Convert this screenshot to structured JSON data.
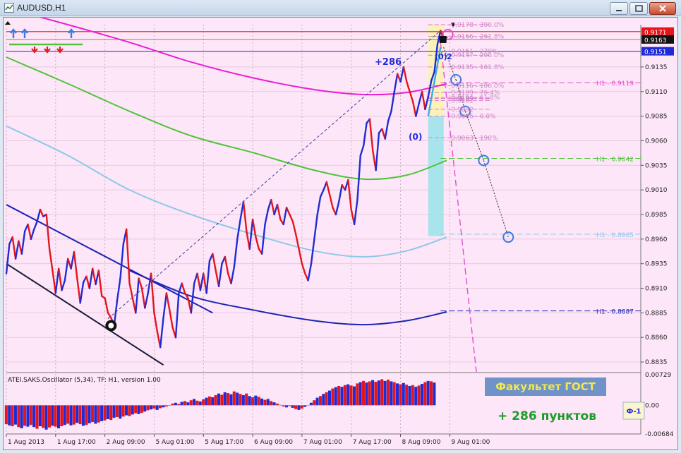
{
  "window": {
    "title": "AUDUSD,H1"
  },
  "colors": {
    "background": "#fde6f7",
    "bull_leg": "#1f2bd6",
    "bear_leg": "#e4161c",
    "ma_magenta": "#ea1fd3",
    "ma_green": "#4fc33a",
    "ma_lightblue": "#8fc8e8",
    "channel_blue": "#1b24b4",
    "channel_dark": "#1a1a3a",
    "fib": "#e07ad0",
    "hist_blue": "#1f2bd6",
    "hist_red": "#e4161c",
    "badge_bg": "#6f93c9",
    "pips_text": "#1f9b2c"
  },
  "chart_data": {
    "type": "line",
    "symbol": "AUDUSD",
    "timeframe": "H1",
    "ylim": [
      0.8825,
      0.9178
    ],
    "y_ticks": [
      "0.9135",
      "0.9110",
      "0.9085",
      "0.9060",
      "0.9035",
      "0.9010",
      "0.8985",
      "0.8960",
      "0.8935",
      "0.8910",
      "0.8885",
      "0.8860",
      "0.8835"
    ],
    "y_tick_values": [
      0.9135,
      0.911,
      0.9085,
      0.906,
      0.9035,
      0.901,
      0.8985,
      0.896,
      0.8935,
      0.891,
      0.8885,
      0.886,
      0.8835
    ],
    "x_ticks": [
      "1 Aug 2013",
      "1 Aug 17:00",
      "2 Aug 09:00",
      "5 Aug 01:00",
      "5 Aug 17:00",
      "6 Aug 09:00",
      "7 Aug 01:00",
      "7 Aug 17:00",
      "8 Aug 09:00",
      "9 Aug 01:00"
    ],
    "x_tick_index": [
      0,
      16,
      32,
      48,
      64,
      80,
      96,
      112,
      128,
      144
    ],
    "price_tags": [
      {
        "label": "0.9171",
        "value": 0.9171,
        "bg": "#e4161c"
      },
      {
        "label": "0.9163",
        "value": 0.9163,
        "bg": "#111111"
      },
      {
        "label": "0.9151",
        "value": 0.9151,
        "bg": "#1f2bd6"
      }
    ],
    "series": [
      {
        "values": [
          [
            0,
            0.8925
          ],
          [
            1,
            0.8955
          ],
          [
            2,
            0.8962
          ],
          [
            3,
            0.894
          ],
          [
            4,
            0.8958
          ],
          [
            5,
            0.8945
          ],
          [
            6,
            0.8968
          ],
          [
            7,
            0.8975
          ],
          [
            8,
            0.896
          ],
          [
            9,
            0.897
          ],
          [
            10,
            0.8978
          ],
          [
            11,
            0.899
          ],
          [
            12,
            0.8983
          ],
          [
            13,
            0.8985
          ],
          [
            14,
            0.895
          ],
          [
            15,
            0.8928
          ],
          [
            16,
            0.8905
          ],
          [
            17,
            0.893
          ],
          [
            18,
            0.8908
          ],
          [
            19,
            0.8918
          ],
          [
            20,
            0.894
          ],
          [
            21,
            0.893
          ],
          [
            22,
            0.8947
          ],
          [
            23,
            0.892
          ],
          [
            24,
            0.8895
          ],
          [
            25,
            0.8916
          ],
          [
            26,
            0.8922
          ],
          [
            27,
            0.891
          ],
          [
            28,
            0.893
          ],
          [
            29,
            0.8914
          ],
          [
            30,
            0.8928
          ],
          [
            31,
            0.8902
          ],
          [
            32,
            0.89
          ],
          [
            33,
            0.8885
          ],
          [
            34,
            0.888
          ],
          [
            35,
            0.8872
          ],
          [
            36,
            0.8898
          ],
          [
            37,
            0.892
          ],
          [
            38,
            0.8955
          ],
          [
            39,
            0.897
          ],
          [
            40,
            0.8915
          ],
          [
            41,
            0.89
          ],
          [
            42,
            0.8885
          ],
          [
            43,
            0.892
          ],
          [
            44,
            0.891
          ],
          [
            45,
            0.889
          ],
          [
            46,
            0.8905
          ],
          [
            47,
            0.8925
          ],
          [
            48,
            0.8885
          ],
          [
            49,
            0.8866
          ],
          [
            50,
            0.885
          ],
          [
            51,
            0.888
          ],
          [
            52,
            0.8905
          ],
          [
            53,
            0.8888
          ],
          [
            54,
            0.887
          ],
          [
            55,
            0.886
          ],
          [
            56,
            0.8905
          ],
          [
            57,
            0.8915
          ],
          [
            58,
            0.8905
          ],
          [
            59,
            0.89
          ],
          [
            60,
            0.8885
          ],
          [
            61,
            0.8915
          ],
          [
            62,
            0.8925
          ],
          [
            63,
            0.8908
          ],
          [
            64,
            0.8925
          ],
          [
            65,
            0.8905
          ],
          [
            66,
            0.8938
          ],
          [
            67,
            0.8945
          ],
          [
            68,
            0.8928
          ],
          [
            69,
            0.8912
          ],
          [
            70,
            0.8935
          ],
          [
            71,
            0.8942
          ],
          [
            72,
            0.8925
          ],
          [
            73,
            0.8915
          ],
          [
            74,
            0.8932
          ],
          [
            75,
            0.896
          ],
          [
            76,
            0.898
          ],
          [
            77,
            0.8998
          ],
          [
            78,
            0.8968
          ],
          [
            79,
            0.895
          ],
          [
            80,
            0.898
          ],
          [
            81,
            0.8962
          ],
          [
            82,
            0.895
          ],
          [
            83,
            0.8945
          ],
          [
            84,
            0.8975
          ],
          [
            85,
            0.899
          ],
          [
            86,
            0.9
          ],
          [
            87,
            0.8985
          ],
          [
            88,
            0.8995
          ],
          [
            89,
            0.898
          ],
          [
            90,
            0.8975
          ],
          [
            91,
            0.8992
          ],
          [
            92,
            0.8985
          ],
          [
            93,
            0.8978
          ],
          [
            94,
            0.8965
          ],
          [
            95,
            0.895
          ],
          [
            96,
            0.8935
          ],
          [
            97,
            0.8925
          ],
          [
            98,
            0.8918
          ],
          [
            99,
            0.8935
          ],
          [
            100,
            0.896
          ],
          [
            101,
            0.8985
          ],
          [
            102,
            0.9003
          ],
          [
            103,
            0.901
          ],
          [
            104,
            0.9018
          ],
          [
            105,
            0.9005
          ],
          [
            106,
            0.8992
          ],
          [
            107,
            0.8985
          ],
          [
            108,
            0.8998
          ],
          [
            109,
            0.9015
          ],
          [
            110,
            0.901
          ],
          [
            111,
            0.902
          ],
          [
            112,
            0.899
          ],
          [
            113,
            0.8975
          ],
          [
            114,
            0.9
          ],
          [
            115,
            0.9045
          ],
          [
            116,
            0.9055
          ],
          [
            117,
            0.9078
          ],
          [
            118,
            0.9082
          ],
          [
            119,
            0.905
          ],
          [
            120,
            0.903
          ],
          [
            121,
            0.9068
          ],
          [
            122,
            0.9072
          ],
          [
            123,
            0.9062
          ],
          [
            124,
            0.908
          ],
          [
            125,
            0.909
          ],
          [
            126,
            0.911
          ],
          [
            127,
            0.9128
          ],
          [
            128,
            0.912
          ],
          [
            129,
            0.9135
          ],
          [
            130,
            0.912
          ],
          [
            131,
            0.911
          ],
          [
            132,
            0.91
          ],
          [
            133,
            0.9085
          ],
          [
            134,
            0.9098
          ],
          [
            135,
            0.911
          ],
          [
            136,
            0.9092
          ],
          [
            137,
            0.9105
          ],
          [
            138,
            0.9121
          ],
          [
            139,
            0.913
          ],
          [
            140,
            0.9158
          ],
          [
            141,
            0.9172
          ],
          [
            142,
            0.9163
          ],
          [
            143,
            0.9165
          ]
        ]
      }
    ],
    "moving_averages": [
      {
        "color": "#ea1fd3",
        "values": [
          [
            0,
            0.9195
          ],
          [
            20,
            0.9178
          ],
          [
            40,
            0.916
          ],
          [
            60,
            0.914
          ],
          [
            80,
            0.9124
          ],
          [
            100,
            0.9112
          ],
          [
            116,
            0.9107
          ],
          [
            130,
            0.9109
          ],
          [
            143,
            0.9118
          ]
        ]
      },
      {
        "color": "#4fc33a",
        "values": [
          [
            0,
            0.9145
          ],
          [
            20,
            0.9118
          ],
          [
            40,
            0.909
          ],
          [
            60,
            0.9065
          ],
          [
            80,
            0.9048
          ],
          [
            100,
            0.903
          ],
          [
            116,
            0.9021
          ],
          [
            130,
            0.9025
          ],
          [
            143,
            0.904
          ]
        ]
      },
      {
        "color": "#8fc8e8",
        "values": [
          [
            0,
            0.9075
          ],
          [
            20,
            0.9045
          ],
          [
            40,
            0.901
          ],
          [
            60,
            0.8985
          ],
          [
            80,
            0.8965
          ],
          [
            100,
            0.8948
          ],
          [
            116,
            0.8942
          ],
          [
            130,
            0.8948
          ],
          [
            143,
            0.8962
          ]
        ]
      },
      {
        "color": "#1b24b4",
        "values": [
          [
            40,
            0.8928
          ],
          [
            60,
            0.8902
          ],
          [
            80,
            0.8888
          ],
          [
            100,
            0.8877
          ],
          [
            116,
            0.8873
          ],
          [
            130,
            0.8877
          ],
          [
            143,
            0.8886
          ]
        ]
      }
    ],
    "channel": [
      {
        "color": "#1b24b4",
        "from": [
          0,
          0.8995
        ],
        "to": [
          67,
          0.8885
        ]
      },
      {
        "color": "#1a1a3a",
        "from": [
          0,
          0.8935
        ],
        "to": [
          51,
          0.8832
        ]
      }
    ],
    "forecast_path": [
      [
        142,
        0.9155
      ],
      [
        146,
        0.9122
      ],
      [
        149,
        0.909
      ],
      [
        155,
        0.904
      ],
      [
        163,
        0.8962
      ]
    ],
    "fib_levels": [
      {
        "label": "0.9178 - 300.0%",
        "value": 0.9178
      },
      {
        "label": "0.9166 - 261.8%",
        "value": 0.9166
      },
      {
        "label": "0.9151 - 270%",
        "value": 0.9151
      },
      {
        "label": "0.9147 - 200.0%",
        "value": 0.9147
      },
      {
        "label": "0.9135 - 161.8%",
        "value": 0.9135
      },
      {
        "label": "0.9116 - 100.0%",
        "value": 0.9116
      },
      {
        "label": "0.9109 - 76.4%",
        "value": 0.9109
      },
      {
        "label": "0.9104 - 61.8%",
        "value": 0.9104
      },
      {
        "label": "0.9103",
        "value": 0.9103
      },
      {
        "label": "0.9101",
        "value": 0.9101
      },
      {
        "label": "0.9092",
        "value": 0.9092
      },
      {
        "label": "0.9085 - 0.0%",
        "value": 0.9085
      },
      {
        "label": "0.9063 - 190%",
        "value": 0.9063
      }
    ],
    "h1_levels": [
      {
        "label": "H1 - 0.9119",
        "value": 0.9119,
        "color": "#e04fd0"
      },
      {
        "label": "H1 - 0.9042",
        "value": 0.9042,
        "color": "#4fc33a"
      },
      {
        "label": "H1 - 0.8965",
        "value": 0.8965,
        "color": "#8fc8e8"
      },
      {
        "label": "H1 - 0.8887",
        "value": 0.8887,
        "color": "#1b24b4"
      }
    ],
    "annotations": {
      "plus": "+286",
      "zero": "(0)",
      "zero_b": "(0)",
      "zero_c": "2"
    },
    "oscillator": {
      "title": "ATEI.SAKS.Oscillator (5,34), TF: H1, version 1.00",
      "ylim": [
        -0.00684,
        0.00729
      ],
      "y_ticks": [
        "0.00729",
        "0.00",
        "-0.00684"
      ],
      "y_tick_values": [
        0.00729,
        0.0,
        -0.00684
      ],
      "values": [
        -0.0045,
        -0.0048,
        -0.005,
        -0.0046,
        -0.0052,
        -0.0055,
        -0.0049,
        -0.0051,
        -0.0047,
        -0.0052,
        -0.0056,
        -0.005,
        -0.0054,
        -0.0058,
        -0.0053,
        -0.0049,
        -0.0051,
        -0.0055,
        -0.005,
        -0.0047,
        -0.0044,
        -0.0048,
        -0.0046,
        -0.0042,
        -0.0045,
        -0.0049,
        -0.0047,
        -0.0043,
        -0.004,
        -0.0044,
        -0.0041,
        -0.0038,
        -0.0036,
        -0.0033,
        -0.0035,
        -0.003,
        -0.0028,
        -0.0032,
        -0.0027,
        -0.0024,
        -0.0026,
        -0.0022,
        -0.0019,
        -0.0021,
        -0.0018,
        -0.0015,
        -0.0012,
        -0.001,
        -0.0008,
        -0.0011,
        -0.0007,
        -0.0005,
        -0.0003,
        0.0,
        0.0004,
        0.0006,
        0.0003,
        0.0008,
        0.001,
        0.0007,
        0.0012,
        0.0015,
        0.0011,
        0.0009,
        0.0014,
        0.0018,
        0.0021,
        0.0019,
        0.0024,
        0.0028,
        0.0025,
        0.0031,
        0.0029,
        0.0026,
        0.0033,
        0.003,
        0.0027,
        0.0024,
        0.0028,
        0.0022,
        0.0019,
        0.0023,
        0.002,
        0.0016,
        0.0013,
        0.0015,
        0.001,
        0.0007,
        0.0004,
        0.0001,
        -0.0003,
        -0.0005,
        -0.0002,
        -0.0006,
        -0.0009,
        -0.0011,
        -0.0008,
        -0.0004,
        0.0,
        0.0006,
        0.0012,
        0.0018,
        0.0022,
        0.0027,
        0.0031,
        0.0035,
        0.004,
        0.0043,
        0.0046,
        0.0044,
        0.0048,
        0.005,
        0.0047,
        0.0045,
        0.0052,
        0.0055,
        0.0058,
        0.0054,
        0.0057,
        0.006,
        0.0056,
        0.0059,
        0.0062,
        0.0058,
        0.0061,
        0.0057,
        0.0055,
        0.0052,
        0.005,
        0.0053,
        0.0049,
        0.0046,
        0.0048,
        0.0044,
        0.0047,
        0.0051,
        0.0055,
        0.0058,
        0.0057,
        0.0054
      ]
    }
  },
  "overlay": {
    "badge": "Факультет ГОСТ",
    "pips": "+ 286 пунктов",
    "tag": "Ф-1"
  }
}
